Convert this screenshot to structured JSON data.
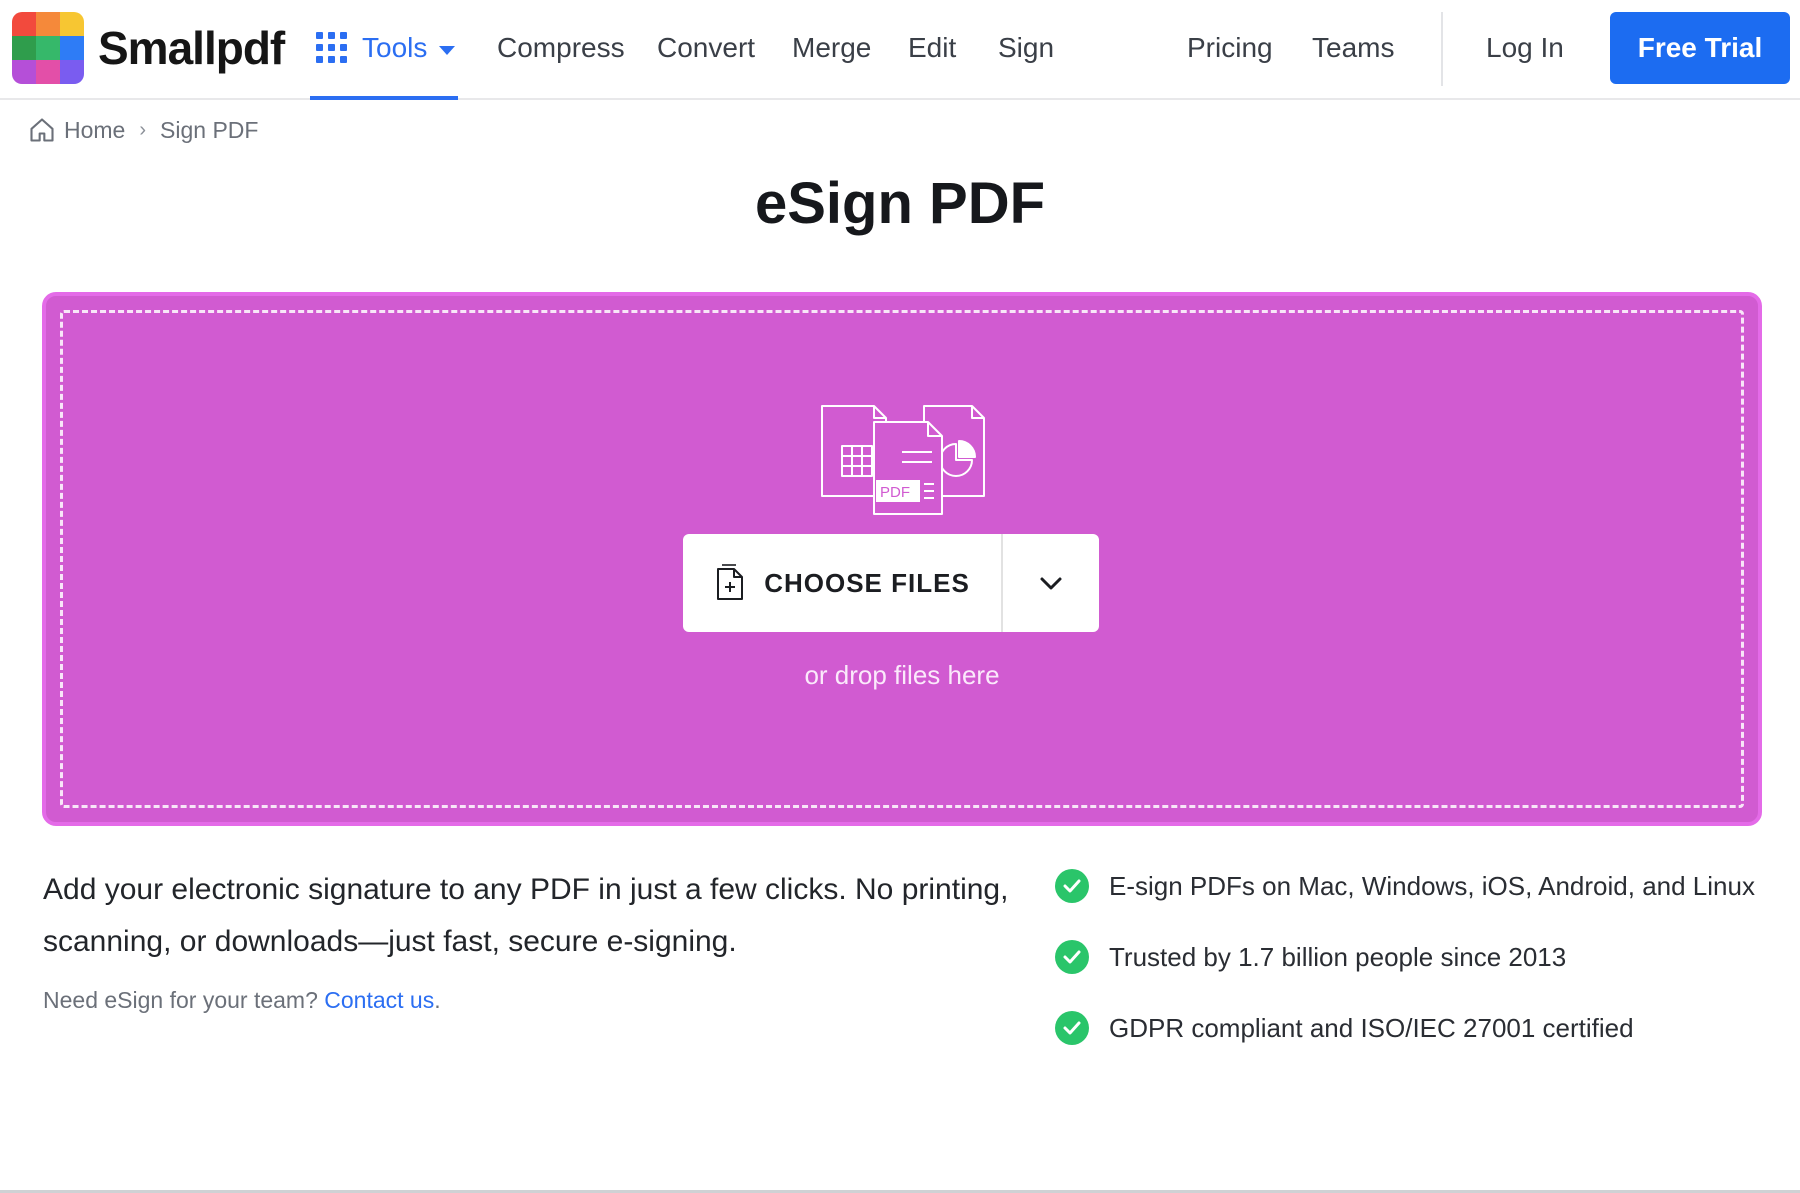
{
  "header": {
    "brand": "Smallpdf",
    "logo_colors": [
      "#f24a3d",
      "#f5893a",
      "#f7c632",
      "#2f9d4c",
      "#36b86a",
      "#2e7cf6",
      "#b54fd8",
      "#e34fa8",
      "#7a5cf0"
    ],
    "tools_label": "Tools",
    "nav": [
      "Compress",
      "Convert",
      "Merge",
      "Edit",
      "Sign",
      "Pricing",
      "Teams"
    ],
    "login_label": "Log In",
    "trial_label": "Free Trial"
  },
  "breadcrumb": {
    "home": "Home",
    "separator": "›",
    "current": "Sign PDF"
  },
  "page_title": "eSign PDF",
  "dropzone": {
    "background_color": "#d15bd1",
    "illustration_badge": "PDF",
    "choose_label": "CHOOSE FILES",
    "hint": "or drop files here"
  },
  "description": "Add your electronic signature to any PDF in just a few clicks. No printing, scanning, or downloads—just fast, secure e-signing.",
  "team_note": {
    "text": "Need eSign for your team?",
    "link": "Contact us",
    "suffix": "."
  },
  "features": [
    "E-sign PDFs on Mac, Windows, iOS, Android, and Linux",
    "Trusted by 1.7 billion people since 2013",
    "GDPR compliant and ISO/IEC 27001 certified"
  ],
  "colors": {
    "accent": "#1c6cf1",
    "check": "#2ac56a"
  }
}
